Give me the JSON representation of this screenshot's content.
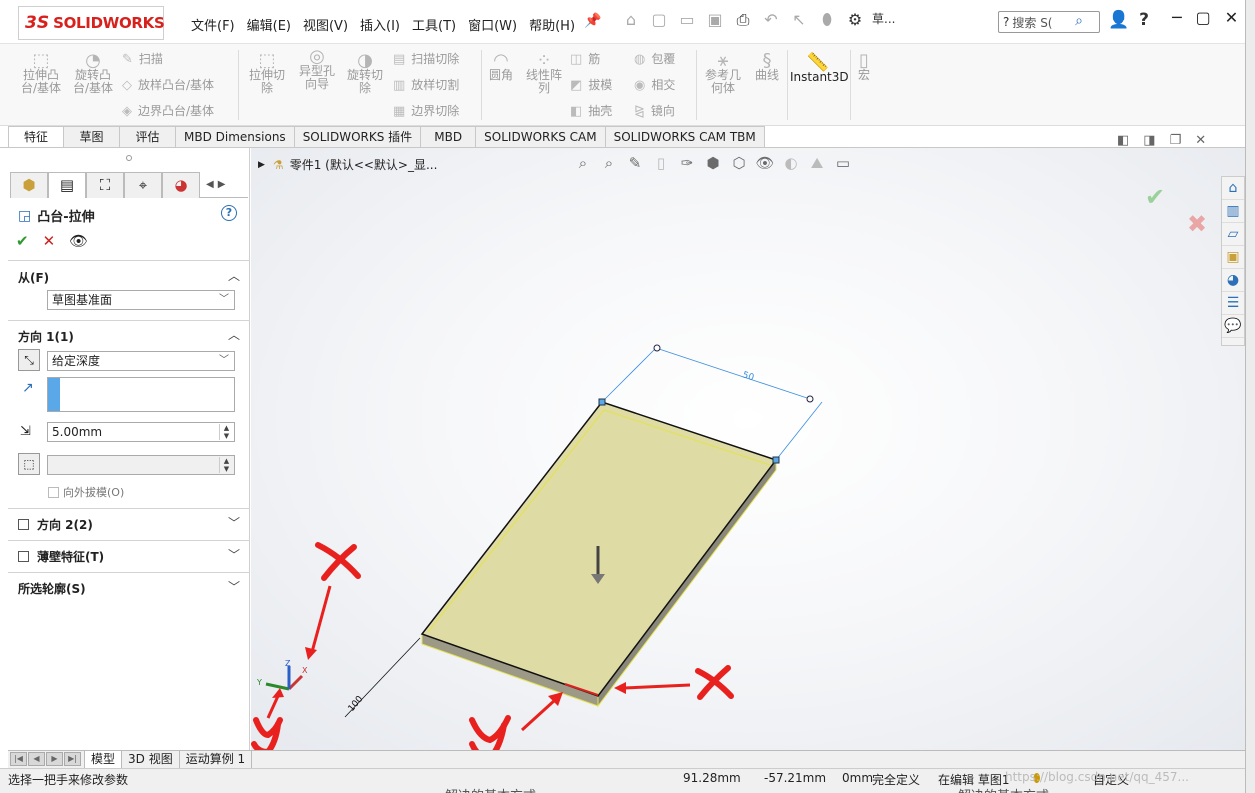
{
  "app": {
    "logo_ds": "3S",
    "logo_text": "SOLIDWORKS",
    "menu": [
      "文件(F)",
      "编辑(E)",
      "视图(V)",
      "插入(I)",
      "工具(T)",
      "窗口(W)",
      "帮助(H)"
    ],
    "search_placeholder": "搜索 S(",
    "truncated_label": "草..."
  },
  "ribbon": {
    "extrude_boss": "拉伸凸\n台/基体",
    "revolve_boss": "旋转凸\n台/基体",
    "sweep": "扫描",
    "loft_boss": "放样凸台/基体",
    "boundary_boss": "边界凸台/基体",
    "extrude_cut": "拉伸切\n除",
    "hole_wizard": "异型孔\n向导",
    "revolve_cut": "旋转切\n除",
    "swept_cut": "扫描切除",
    "lofted_cut": "放样切割",
    "boundary_cut": "边界切除",
    "fillet": "圆角",
    "linear_pattern": "线性阵\n列",
    "rib": "筋",
    "draft": "拔模",
    "shell": "抽壳",
    "wrap": "包覆",
    "intersect": "相交",
    "mirror": "镜向",
    "ref_geometry": "参考几\n何体",
    "curves": "曲线",
    "instant3d": "Instant3D",
    "macro": "宏"
  },
  "tabs": [
    "特征",
    "草图",
    "评估",
    "MBD Dimensions",
    "SOLIDWORKS 插件",
    "MBD",
    "SOLIDWORKS CAM",
    "SOLIDWORKS CAM TBM"
  ],
  "property_manager": {
    "title": "凸台-拉伸",
    "from_label": "从(F)",
    "from_value": "草图基准面",
    "direction1_label": "方向 1(1)",
    "end_condition": "给定深度",
    "depth_value": "5.00mm",
    "draft_outward": "向外拔模(O)",
    "direction2_label": "方向 2(2)",
    "thin_feature_label": "薄壁特征(T)",
    "selected_contours_label": "所选轮廓(S)"
  },
  "viewport": {
    "doc_title": "零件1  (默认<<默认>_显...",
    "dim_50": "50",
    "dim_100": "100",
    "axis_x": "X",
    "axis_y": "Y",
    "axis_z": "Z"
  },
  "bottom_tabs": [
    "模型",
    "3D 视图",
    "运动算例 1"
  ],
  "status": {
    "hint": "选择一把手来修改参数",
    "x_coord": "91.28mm",
    "y_coord": "-57.21mm",
    "z_coord": "0mm",
    "definition": "完全定义",
    "editing": "在编辑 草图1",
    "custom": "自定义"
  },
  "background": {
    "behind_text_1": "解决的基本方式:",
    "behind_text_2": "解决的基本方式:",
    "watermark": "https://blog.csdn.net/qq_457..."
  },
  "colors": {
    "brand": "#d8201c",
    "face_fill": "#dedca4",
    "edge_yellow": "#e4e24a",
    "annotation_red": "#e8211f",
    "dimension_blue": "#3a8de0"
  }
}
